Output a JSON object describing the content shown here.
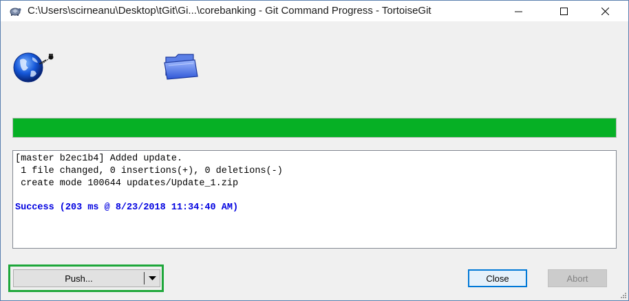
{
  "window": {
    "title": "C:\\Users\\scirneanu\\Desktop\\tGit\\Gi...\\corebanking - Git Command Progress - TortoiseGit"
  },
  "progress": {
    "value_percent": 100,
    "color": "#06b025"
  },
  "log": {
    "lines": [
      "[master b2ec1b4] Added update.",
      " 1 file changed, 0 insertions(+), 0 deletions(-)",
      " create mode 100644 updates/Update_1.zip"
    ],
    "status": "Success (203 ms @ 8/23/2018 11:34:40 AM)",
    "status_color": "#0000e0"
  },
  "buttons": {
    "push_label": "Push...",
    "close_label": "Close",
    "abort_label": "Abort"
  },
  "colors": {
    "highlight": "#1ea73a",
    "focus_border": "#0078d7"
  },
  "icons": [
    "tortoisegit-icon",
    "minimize-icon",
    "maximize-icon",
    "close-icon",
    "globe-network-icon",
    "folder-icon",
    "chevron-down-icon",
    "resize-grip-icon"
  ]
}
